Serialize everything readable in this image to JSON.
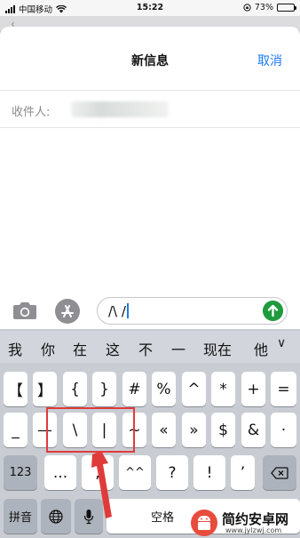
{
  "status_bar": {
    "carrier": "中国移动",
    "time": "15:22",
    "battery": "73%",
    "battery_level": 0.73
  },
  "header": {
    "title": "新信息",
    "cancel_label": "取消"
  },
  "recipient": {
    "label": "收件人:"
  },
  "compose": {
    "text": "/\\ /"
  },
  "candidates": [
    "我",
    "你",
    "在",
    "这",
    "不",
    "一",
    "现在",
    "他"
  ],
  "keyboard": {
    "row1": [
      "【",
      "】",
      "{",
      "}",
      "#",
      "%",
      "^",
      "*",
      "+",
      "="
    ],
    "row2": [
      "_",
      "—",
      "\\",
      "|",
      "~",
      "«",
      "»",
      "$",
      "&",
      "·"
    ],
    "row3": {
      "mode": "123",
      "keys": [
        "...",
        ",",
        "^^",
        "?",
        "!",
        "’"
      ]
    },
    "row4": {
      "lang": "拼音",
      "space": "空格"
    }
  },
  "icons": {
    "camera": "camera-icon",
    "appstore": "appstore-icon",
    "send": "send-arrow-icon",
    "backspace": "backspace-icon",
    "globe": "globe-icon",
    "mic": "microphone-icon",
    "chevron": "chevron-down-icon"
  },
  "colors": {
    "accent": "#1a7af0",
    "send": "#1f9b3d",
    "highlight": "#e03b3b",
    "watermark_logo": "#e84c3d"
  },
  "watermark": {
    "title": "简约安卓网",
    "url": "www.jylzwj.com"
  }
}
